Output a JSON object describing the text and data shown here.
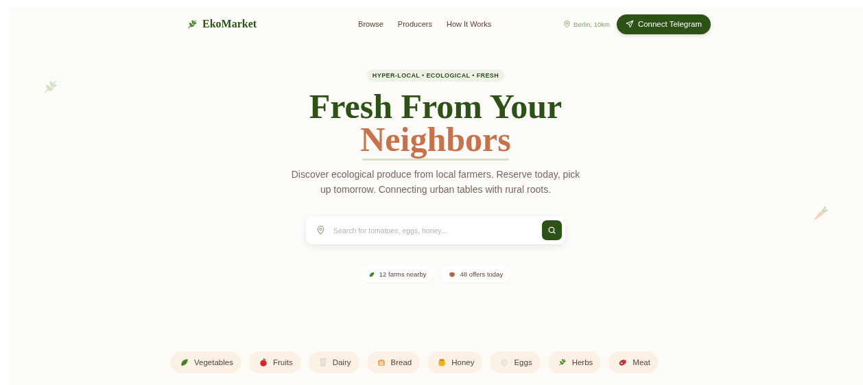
{
  "brand": {
    "name": "EkoMarket"
  },
  "nav": [
    {
      "label": "Browse"
    },
    {
      "label": "Producers"
    },
    {
      "label": "How It Works"
    }
  ],
  "location": "Berlin, 10km",
  "cta": "Connect Telegram",
  "hero": {
    "badge": "HYPER-LOCAL • ECOLOGICAL • FRESH",
    "title": "Fresh From Your",
    "title_accent": "Neighbors",
    "description": "Discover ecological produce from local farmers. Reserve today, pick up tomorrow. Connecting urban tables with rural roots.",
    "search": {
      "placeholder": "Search for tomatoes, eggs, honey..."
    },
    "stats": [
      {
        "kind": "farms",
        "label": "12 farms nearby"
      },
      {
        "kind": "offers",
        "label": "48 offers today"
      }
    ]
  },
  "categories": [
    {
      "kind": "vegetables",
      "label": "Vegetables"
    },
    {
      "kind": "fruits",
      "label": "Fruits"
    },
    {
      "kind": "dairy",
      "label": "Dairy"
    },
    {
      "kind": "bread",
      "label": "Bread"
    },
    {
      "kind": "honey",
      "label": "Honey"
    },
    {
      "kind": "eggs",
      "label": "Eggs"
    },
    {
      "kind": "herbs",
      "label": "Herbs"
    },
    {
      "kind": "meat",
      "label": "Meat"
    }
  ]
}
